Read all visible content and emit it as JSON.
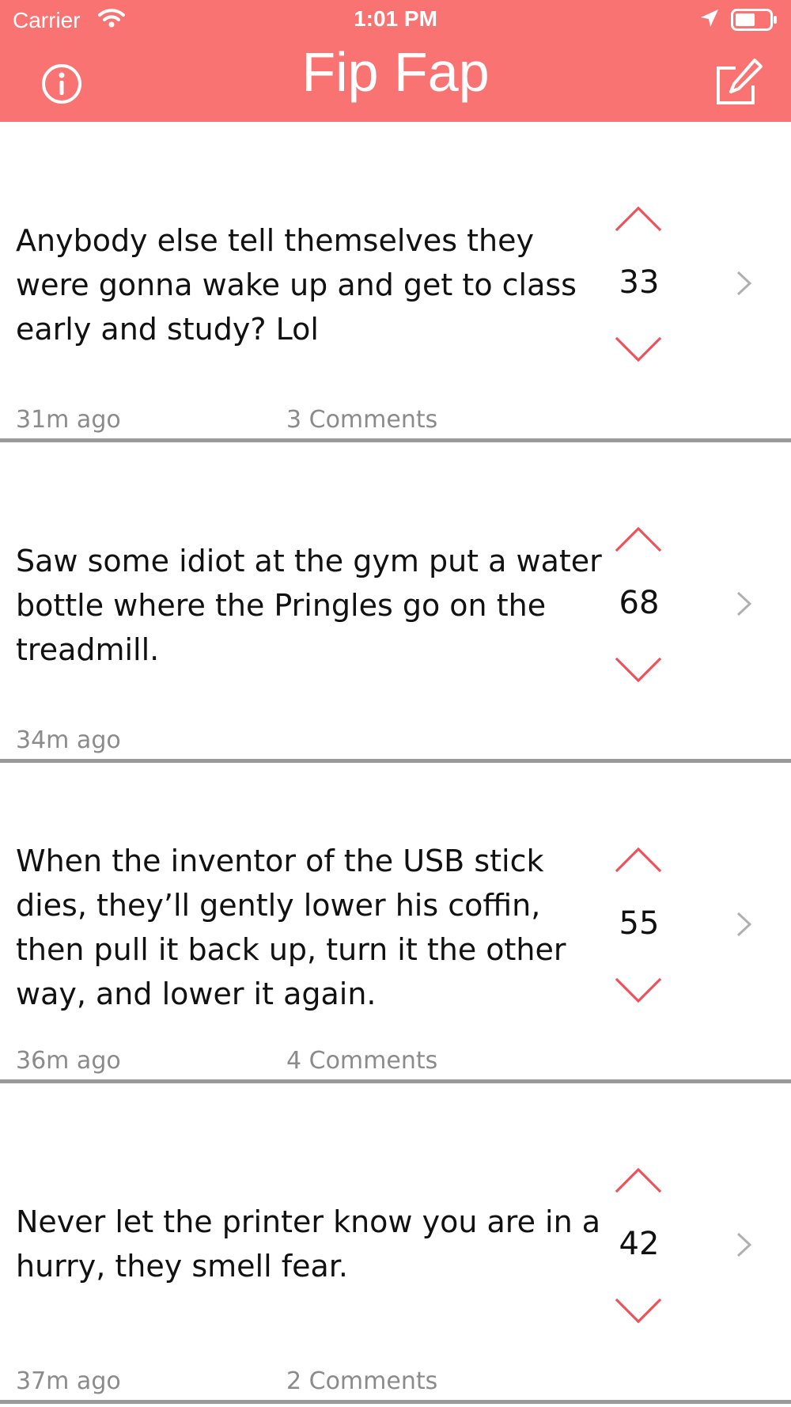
{
  "status_bar": {
    "carrier": "Carrier",
    "time": "1:01 PM"
  },
  "header": {
    "title": "Fip Fap"
  },
  "icons": {
    "info": "info-circle-icon",
    "compose": "compose-icon",
    "upvote": "chevron-up-icon",
    "downvote": "chevron-down-icon",
    "disclosure": "chevron-right-icon"
  },
  "colors": {
    "accent": "#F97373",
    "meta": "#8B8B8B",
    "divider": "#9A9A9A"
  },
  "posts": [
    {
      "text": "Anybody else tell themselves they were gonna wake up and get to class early and study? Lol",
      "score": "33",
      "time": "31m ago",
      "comments": "3 Comments"
    },
    {
      "text": "Saw some idiot at the gym put a water bottle where the Pringles go on the treadmill.",
      "score": "68",
      "time": "34m ago",
      "comments": ""
    },
    {
      "text": "When the inventor of the USB stick dies, they’ll gently lower his coffin, then pull it back up, turn it the other way, and lower it again.",
      "score": "55",
      "time": "36m ago",
      "comments": "4 Comments"
    },
    {
      "text": "Never let the printer know you are in a hurry, they smell fear.",
      "score": "42",
      "time": "37m ago",
      "comments": "2 Comments"
    }
  ]
}
